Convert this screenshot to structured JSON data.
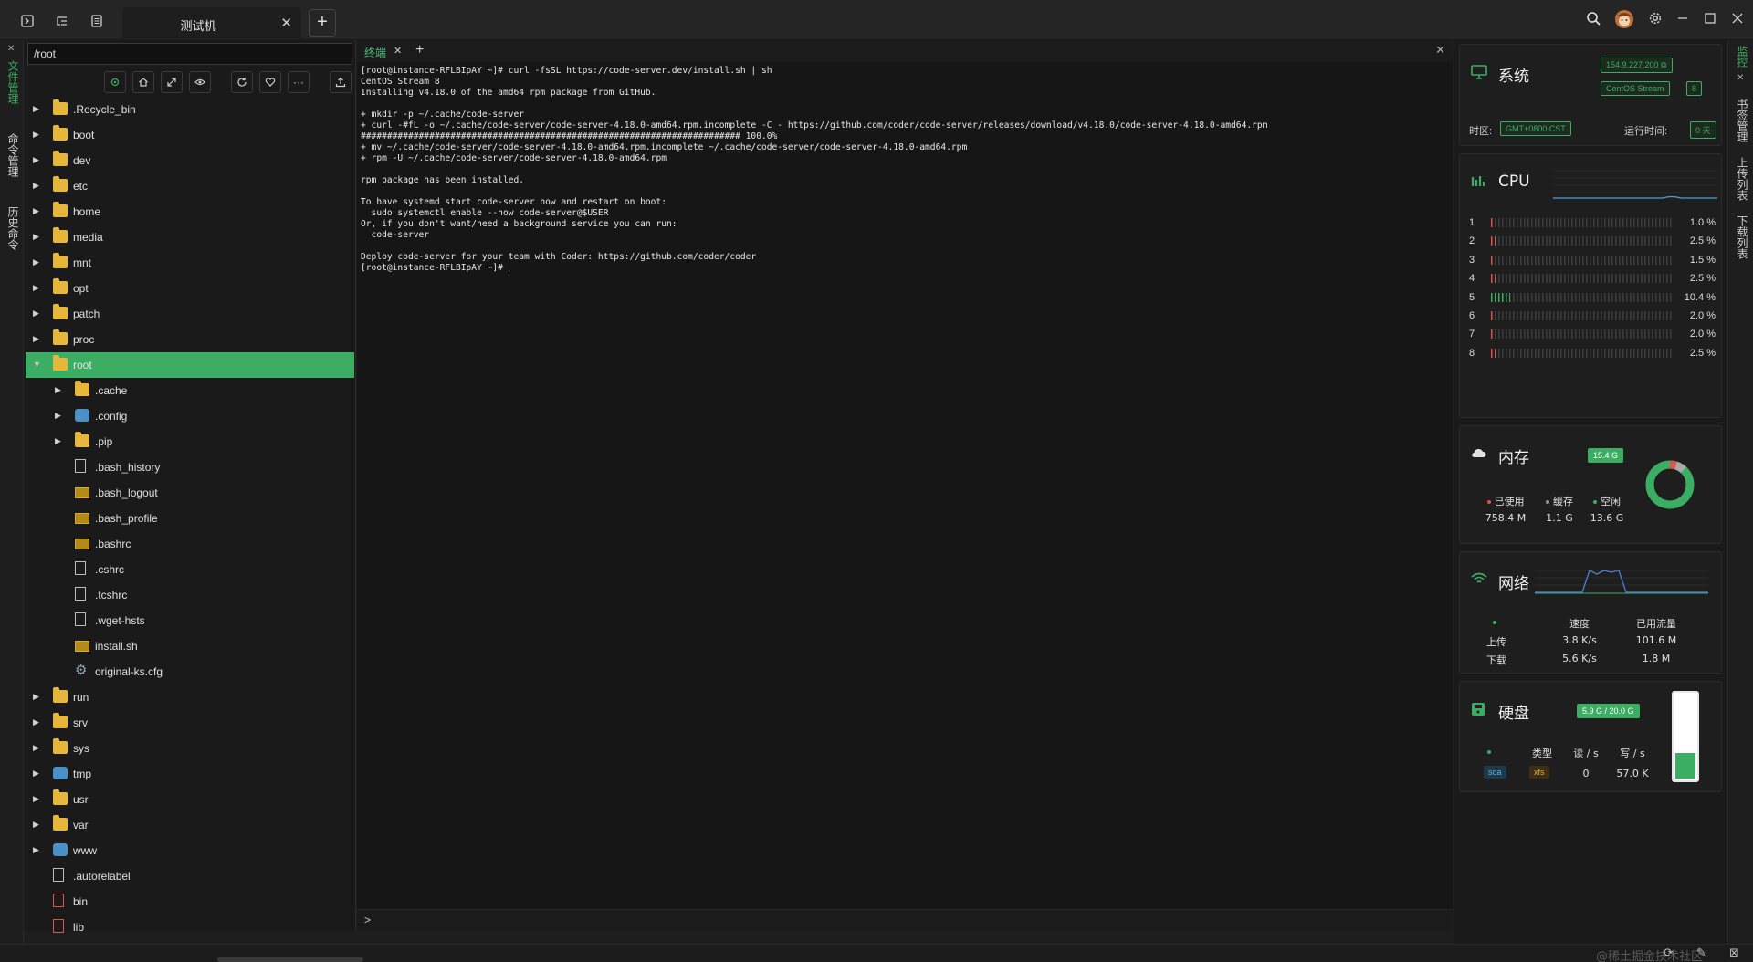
{
  "window": {
    "tab_title": "测试机",
    "tab_close": "✕",
    "new_tab": "+"
  },
  "left_strip": {
    "items": [
      "文件管理",
      "命令管理",
      "历史命令"
    ]
  },
  "file_panel": {
    "path": "/root",
    "tree": [
      {
        "label": ".Recycle_bin",
        "type": "folder",
        "depth": 0,
        "expanded": false
      },
      {
        "label": "boot",
        "type": "folder",
        "depth": 0,
        "expanded": false
      },
      {
        "label": "dev",
        "type": "folder",
        "depth": 0,
        "expanded": false
      },
      {
        "label": "etc",
        "type": "folder",
        "depth": 0,
        "expanded": false
      },
      {
        "label": "home",
        "type": "folder",
        "depth": 0,
        "expanded": false
      },
      {
        "label": "media",
        "type": "folder",
        "depth": 0,
        "expanded": false
      },
      {
        "label": "mnt",
        "type": "folder",
        "depth": 0,
        "expanded": false
      },
      {
        "label": "opt",
        "type": "folder",
        "depth": 0,
        "expanded": false
      },
      {
        "label": "patch",
        "type": "folder",
        "depth": 0,
        "expanded": false
      },
      {
        "label": "proc",
        "type": "folder",
        "depth": 0,
        "expanded": false
      },
      {
        "label": "root",
        "type": "folder",
        "depth": 0,
        "expanded": true,
        "selected": true
      },
      {
        "label": ".cache",
        "type": "folder",
        "depth": 1,
        "expanded": false
      },
      {
        "label": ".config",
        "type": "special",
        "depth": 1,
        "expanded": false
      },
      {
        "label": ".pip",
        "type": "folder",
        "depth": 1,
        "expanded": false
      },
      {
        "label": ".bash_history",
        "type": "file",
        "depth": 1
      },
      {
        "label": ".bash_logout",
        "type": "script",
        "depth": 1
      },
      {
        "label": ".bash_profile",
        "type": "script",
        "depth": 1
      },
      {
        "label": ".bashrc",
        "type": "script",
        "depth": 1
      },
      {
        "label": ".cshrc",
        "type": "file",
        "depth": 1
      },
      {
        "label": ".tcshrc",
        "type": "file",
        "depth": 1
      },
      {
        "label": ".wget-hsts",
        "type": "file",
        "depth": 1
      },
      {
        "label": "install.sh",
        "type": "script",
        "depth": 1
      },
      {
        "label": "original-ks.cfg",
        "type": "gear",
        "depth": 1
      },
      {
        "label": "run",
        "type": "folder",
        "depth": 0,
        "expanded": false
      },
      {
        "label": "srv",
        "type": "folder",
        "depth": 0,
        "expanded": false
      },
      {
        "label": "sys",
        "type": "folder",
        "depth": 0,
        "expanded": false
      },
      {
        "label": "tmp",
        "type": "special",
        "depth": 0,
        "expanded": false
      },
      {
        "label": "usr",
        "type": "folder",
        "depth": 0,
        "expanded": false
      },
      {
        "label": "var",
        "type": "folder",
        "depth": 0,
        "expanded": false
      },
      {
        "label": "www",
        "type": "special",
        "depth": 0,
        "expanded": false
      },
      {
        "label": ".autorelabel",
        "type": "file",
        "depth": 0
      },
      {
        "label": "bin",
        "type": "bin",
        "depth": 0
      },
      {
        "label": "lib",
        "type": "bin",
        "depth": 0
      }
    ]
  },
  "terminal": {
    "tab_label": "终端",
    "lines": [
      "[root@instance-RFLBIpAY ~]# curl -fsSL https://code-server.dev/install.sh | sh",
      "CentOS Stream 8",
      "Installing v4.18.0 of the amd64 rpm package from GitHub.",
      "",
      "+ mkdir -p ~/.cache/code-server",
      "+ curl -#fL -o ~/.cache/code-server/code-server-4.18.0-amd64.rpm.incomplete -C - https://github.com/coder/code-server/releases/download/v4.18.0/code-server-4.18.0-amd64.rpm",
      "######################################################################## 100.0%",
      "+ mv ~/.cache/code-server/code-server-4.18.0-amd64.rpm.incomplete ~/.cache/code-server/code-server-4.18.0-amd64.rpm",
      "+ rpm -U ~/.cache/code-server/code-server-4.18.0-amd64.rpm",
      "",
      "rpm package has been installed.",
      "",
      "To have systemd start code-server now and restart on boot:",
      "  sudo systemctl enable --now code-server@$USER",
      "Or, if you don't want/need a background service you can run:",
      "  code-server",
      "",
      "Deploy code-server for your team with Coder: https://github.com/coder/coder"
    ],
    "prompt": "[root@instance-RFLBIpAY ~]# ",
    "input_arrow": ">"
  },
  "system": {
    "title": "系统",
    "ip": "154.9.227.200",
    "os": "CentOS Stream",
    "os_version": "8",
    "tz_label": "时区:",
    "tz_value": "GMT+0800  CST",
    "uptime_label": "运行时间:",
    "uptime_value": "0 天"
  },
  "cpu": {
    "title": "CPU",
    "cores": [
      {
        "n": "1",
        "pct": 1.0,
        "label": "1.0 %"
      },
      {
        "n": "2",
        "pct": 2.5,
        "label": "2.5 %"
      },
      {
        "n": "3",
        "pct": 1.5,
        "label": "1.5 %"
      },
      {
        "n": "4",
        "pct": 2.5,
        "label": "2.5 %"
      },
      {
        "n": "5",
        "pct": 10.4,
        "label": "10.4 %"
      },
      {
        "n": "6",
        "pct": 2.0,
        "label": "2.0 %"
      },
      {
        "n": "7",
        "pct": 2.0,
        "label": "2.0 %"
      },
      {
        "n": "8",
        "pct": 2.5,
        "label": "2.5 %"
      }
    ]
  },
  "memory": {
    "title": "内存",
    "total": "15.4 G",
    "used_label": "已使用",
    "cache_label": "缓存",
    "free_label": "空闲",
    "used": "758.4 M",
    "cache": "1.1 G",
    "free": "13.6 G",
    "used_frac": 0.048,
    "cache_frac": 0.071
  },
  "network": {
    "title": "网络",
    "speed_header": "速度",
    "traffic_header": "已用流量",
    "upload_label": "上传",
    "download_label": "下载",
    "upload_speed": "3.8 K/s",
    "download_speed": "5.6 K/s",
    "upload_total": "101.6 M",
    "download_total": "1.8 M"
  },
  "disk": {
    "title": "硬盘",
    "usage": "5.9 G / 20.0 G",
    "used_frac": 0.295,
    "type_header": "类型",
    "read_header": "读 / s",
    "write_header": "写 / s",
    "device": "sda",
    "fs": "xfs",
    "read": "0",
    "write": "57.0 K"
  },
  "right_strip": {
    "items": [
      "监控",
      "书签管理",
      "上传列表",
      "下载列表"
    ]
  },
  "watermark": "@稀土掘金技术社区",
  "colors": {
    "accent": "#3cae63",
    "folder": "#e7b73b",
    "danger": "#d9534f"
  }
}
